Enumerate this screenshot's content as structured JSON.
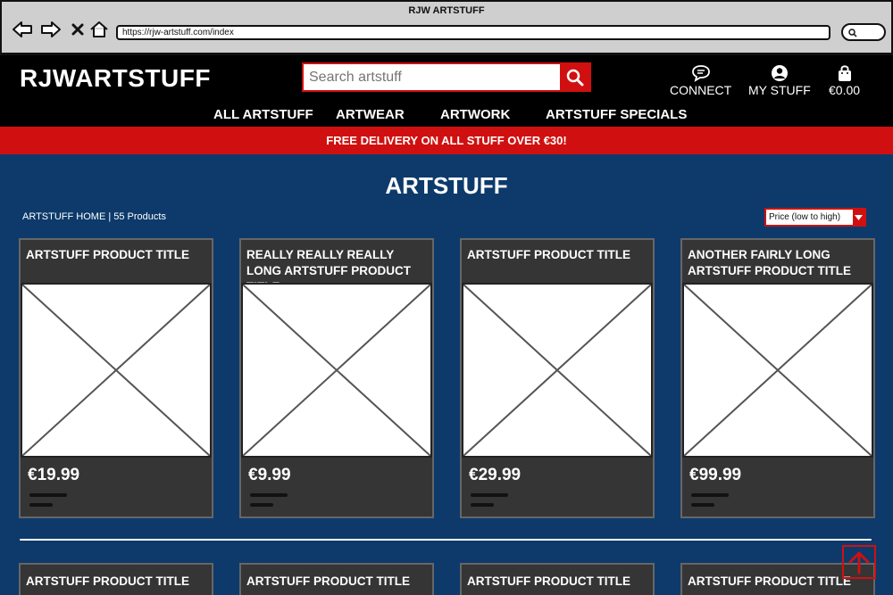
{
  "browser": {
    "window_title": "RJW ARTSTUFF",
    "url": "https://rjw-artstuff.com/index",
    "icons": [
      "back-arrow-icon",
      "forward-arrow-icon",
      "close-icon",
      "home-icon",
      "search-icon"
    ]
  },
  "header": {
    "logo": "RJWARTSTUFF",
    "search_placeholder": "Search artstuff",
    "connect_label": "CONNECT",
    "mystuff_label": "MY STUFF",
    "cart_total": "€0.00",
    "nav": [
      "ALL ARTSTUFF",
      "ARTWEAR",
      "ARTWORK",
      "ARTSTUFF SPECIALS"
    ]
  },
  "promo": "FREE DELIVERY ON ALL STUFF OVER €30!",
  "main": {
    "title": "ARTSTUFF",
    "breadcrumb": "ARTSTUFF HOME | 55 Products",
    "sort_selected": "Price (low to high)"
  },
  "products": [
    {
      "title": "ARTSTUFF PRODUCT TITLE",
      "price": "€19.99"
    },
    {
      "title": "REALLY REALLY REALLY LONG ARTSTUFF PRODUCT TITLE",
      "price": "€9.99"
    },
    {
      "title": "ARTSTUFF PRODUCT TITLE",
      "price": "€29.99"
    },
    {
      "title": "ANOTHER FAIRLY LONG ARTSTUFF PRODUCT TITLE",
      "price": "€99.99"
    }
  ],
  "products_row2": [
    {
      "title": "ARTSTUFF PRODUCT TITLE"
    },
    {
      "title": "ARTSTUFF PRODUCT TITLE"
    },
    {
      "title": "ARTSTUFF PRODUCT TITLE"
    },
    {
      "title": "ARTSTUFF PRODUCT TITLE"
    }
  ],
  "colors": {
    "accent": "#d01010",
    "page_bg": "#0d3a6b",
    "header_bg": "#000000",
    "card_bg": "#353535"
  }
}
